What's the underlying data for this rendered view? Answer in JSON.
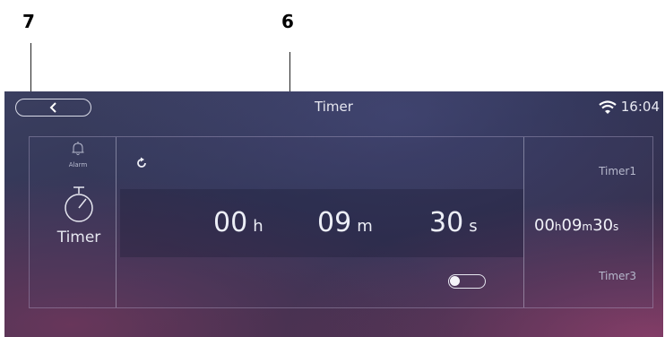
{
  "callouts": {
    "left": "7",
    "center": "6"
  },
  "status_bar": {
    "title": "Timer",
    "time": "16:04",
    "wifi_icon": "wifi-icon"
  },
  "back_button": {
    "icon": "chevron-left-icon"
  },
  "tabs": {
    "alarm": {
      "label": "Alarm",
      "icon": "bell-icon"
    },
    "timer": {
      "label": "Timer",
      "icon": "stopwatch-icon"
    }
  },
  "timer": {
    "hours": "00",
    "hours_unit": "h",
    "minutes": "09",
    "minutes_unit": "m",
    "seconds": "30",
    "seconds_unit": "s",
    "reset_icon": "reset-icon",
    "toggle_on": false
  },
  "presets": {
    "timer1_label": "Timer1",
    "current": {
      "h": "00",
      "h_unit": "h",
      "m": "09",
      "m_unit": "m",
      "s": "30",
      "s_unit": "s"
    },
    "timer3_label": "Timer3"
  }
}
